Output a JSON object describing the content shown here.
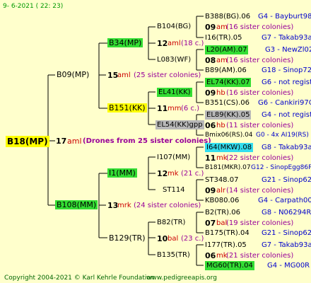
{
  "date": "9- 6-2021 ( 22: 23)",
  "root": {
    "id": "B18(MP)",
    "num": "17",
    "code": "aml",
    "note": "(Drones from 25 sister colonies)"
  },
  "gen1": [
    {
      "id": "B09(MP)",
      "num": "15",
      "code": "aml",
      "note": "(25 sister colonies)"
    },
    {
      "id": "B108(MM)",
      "num": "13",
      "code": "mrk",
      "note": "(24 sister colonies)"
    }
  ],
  "gen2": [
    {
      "id": "B34(MP)",
      "num": "12",
      "code": "aml",
      "note": "(18 c.)"
    },
    {
      "id": "L083(WF)"
    },
    {
      "id": "B151(KK)",
      "num": "11",
      "code": "mm",
      "note": "(6 c.)"
    },
    {
      "id": "EL54(KK)gpp"
    },
    {
      "id": "I1(MM)",
      "num": "12",
      "code": "mk",
      "note": "(21 c.)"
    },
    {
      "id": "ST114"
    },
    {
      "id": "B129(TR)",
      "num": "10",
      "code": "bal",
      "note": "(23 c.)"
    },
    {
      "id": "B82(TR)"
    },
    {
      "id": "B135(TR)"
    },
    {
      "id": "B104(BG)"
    },
    {
      "id": "I107(MM)"
    }
  ],
  "gen3": [
    {
      "id": "B388(BG).06",
      "loc": "G4 - Bayburt98-3"
    },
    {
      "num": "09",
      "code": "am",
      "note": "(16 sister colonies)"
    },
    {
      "id": "I16(TR).05",
      "loc": "G7 - Takab93aR"
    },
    {
      "id": "L20(AM).07",
      "loc": "G3 - NewZl02Q"
    },
    {
      "num": "08",
      "code": "am",
      "note": "(16 sister colonies)"
    },
    {
      "id": "B89(AM).06",
      "loc": "G18 - Sinop72R"
    },
    {
      "id": "EL74(KK).07",
      "loc": "G6 - not registe"
    },
    {
      "num": "09",
      "code": "hb",
      "note": "(16 sister colonies)"
    },
    {
      "id": "B351(CS).06",
      "loc": "G6 - Cankiri97Q"
    },
    {
      "id": "EL89(KK).05",
      "loc": "G4 - not registe"
    },
    {
      "num": "06",
      "code": "hb",
      "note": "(11 sister colonies)"
    },
    {
      "id": "Bmix06(RS).04",
      "loc": "G0 - 4x AI19(RS)"
    },
    {
      "id": "I64(MKW).08",
      "loc": "G8 - Takab93aR"
    },
    {
      "num": "11",
      "code": "mk",
      "note": "(22 sister colonies)"
    },
    {
      "id": "B181(MKR).07",
      "loc": "G12 - SinopEgg86R"
    },
    {
      "id": "ST348.07",
      "loc": "G21 - Sinop62R"
    },
    {
      "num": "09",
      "code": "alr",
      "note": "(14 sister colonies)"
    },
    {
      "id": "KB080.06",
      "loc": "G4 - Carpath00R"
    },
    {
      "id": "B2(TR).06",
      "loc": "G8 - N06294R"
    },
    {
      "num": "07",
      "code": "bal",
      "note": "(19 sister colonies)"
    },
    {
      "id": "B175(TR).04",
      "loc": "G21 - Sinop62R"
    },
    {
      "id": "I177(TR).05",
      "loc": "G7 - Takab93aR"
    },
    {
      "num": "06",
      "code": "mk",
      "note": "(21 sister colonies)"
    },
    {
      "id": "MG60(TR).04",
      "loc": "G4 - MG00R"
    }
  ],
  "footer": {
    "copyright": "Copyright 2004-2021 © Karl Kehrle Foundation",
    "url": "www.pedigreeapis.org"
  }
}
